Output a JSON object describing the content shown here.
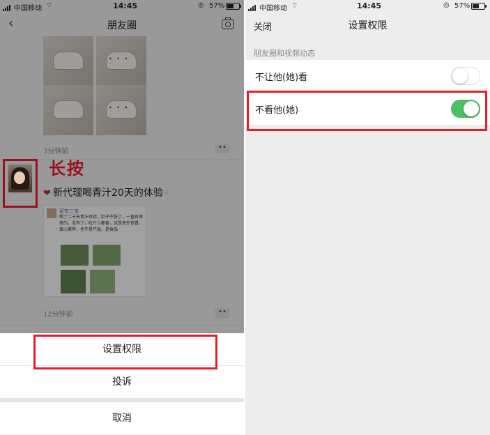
{
  "left_screen": {
    "status": {
      "carrier": "中国移动",
      "time": "14:45",
      "battery": "57%",
      "battery_level": 0.57
    },
    "nav": {
      "title": "朋友圈"
    },
    "post1": {
      "time": "3分钟前",
      "more": "••"
    },
    "annotation": {
      "long_press": "长按"
    },
    "post2": {
      "text": "新代理喝青汁20天的体验",
      "card_name": "家有三宝",
      "card_text": "喝了二十天青汁体验，肚子不胀了，一直有痔疮的，没有了，吃什么都香，这是意外惊喜，真心推荐，也不是产品，是食品",
      "time": "12分钟前",
      "more": "••"
    },
    "action_sheet": {
      "items": [
        "设置权限",
        "投诉"
      ],
      "cancel": "取消"
    }
  },
  "right_screen": {
    "status": {
      "carrier": "中国移动",
      "time": "14:45",
      "battery": "57%",
      "battery_level": 0.57
    },
    "nav": {
      "close": "关闭",
      "title": "设置权限"
    },
    "section_label": "朋友圈和视频动态",
    "settings": [
      {
        "label": "不让他(她)看",
        "on": false
      },
      {
        "label": "不看他(她)",
        "on": true
      }
    ]
  },
  "colors": {
    "highlight": "#e81c2b",
    "toggle_on": "#4cbf66"
  }
}
